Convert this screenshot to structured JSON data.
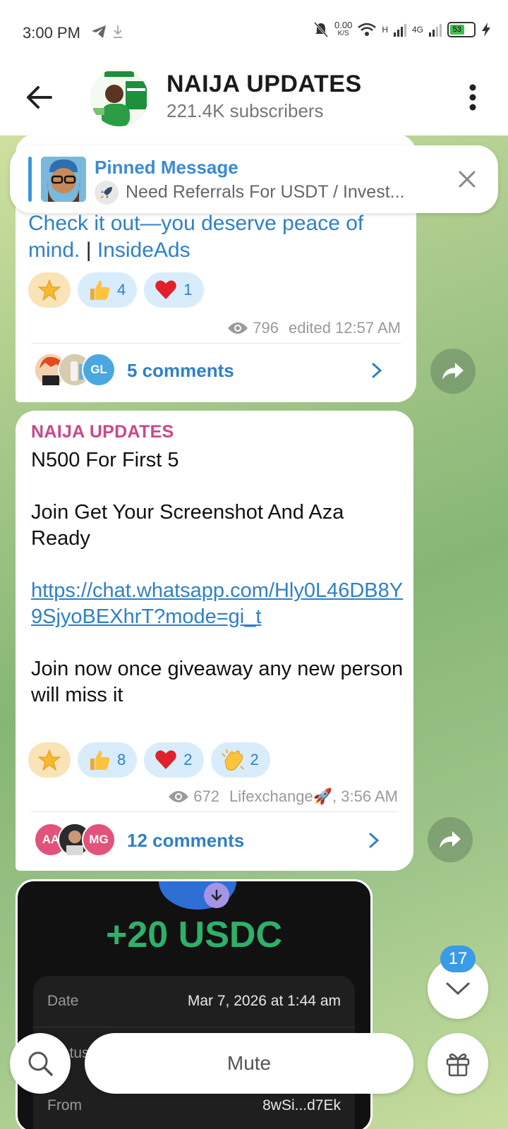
{
  "status": {
    "time": "3:00 PM",
    "net_speed": "0.00",
    "net_unit": "K/S",
    "network_1": "H",
    "network_2": "4G",
    "battery": "53"
  },
  "header": {
    "title": "NAIJA UPDATES",
    "subscribers": "221.4K subscribers"
  },
  "pinned": {
    "title": "Pinned Message",
    "text": "Need Referrals For USDT / Invest..."
  },
  "message1": {
    "text_link": "Check it out—you deserve peace of mind.",
    "text_sep": " | ",
    "text_ads": "InsideAds",
    "reactions": [
      {
        "emoji": "star",
        "count": ""
      },
      {
        "emoji": "thumbs-up",
        "count": "4"
      },
      {
        "emoji": "heart",
        "count": "1"
      }
    ],
    "views": "796",
    "edited": "edited 12:57 AM",
    "comment_avatars": [
      "",
      "",
      "GL"
    ],
    "comments": "5 comments"
  },
  "message2": {
    "author": "NAIJA UPDATES",
    "line1": "N500 For First 5",
    "line2": "Join Get Your Screenshot And Aza Ready",
    "link": "https://chat.whatsapp.com/Hly0L46DB8Y9SjyoBEXhrT?mode=gi_t",
    "line3": "Join now once giveaway any new person will miss it",
    "reactions": [
      {
        "emoji": "star",
        "count": ""
      },
      {
        "emoji": "thumbs-up",
        "count": "8"
      },
      {
        "emoji": "heart",
        "count": "2"
      },
      {
        "emoji": "clapping",
        "count": "2"
      }
    ],
    "views": "672",
    "signature": "Lifexchange🚀, 3:56 AM",
    "comment_avatars": [
      "AA",
      "",
      "MG"
    ],
    "comments": "12 comments"
  },
  "image_message": {
    "amount": "+20 USDC",
    "rows": [
      {
        "label": "Date",
        "value": "Mar 7, 2026 at 1:44 am"
      },
      {
        "label": "Status",
        "value": ""
      },
      {
        "label": "From",
        "value": "8wSi...d7Ek"
      }
    ]
  },
  "scroll": {
    "unread": "17"
  },
  "bottom": {
    "mute_label": "Mute"
  },
  "colors": {
    "accent": "#2f80c8",
    "author": "#c9478a",
    "badge": "#3a9be6",
    "usdc_green": "#2fb06a"
  }
}
